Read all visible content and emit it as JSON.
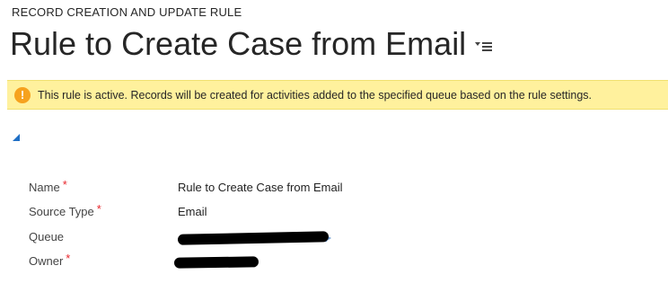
{
  "header": {
    "entity_type": "RECORD CREATION AND UPDATE RULE",
    "record_title": "Rule to Create Case from Email"
  },
  "notification": {
    "icon": "warning-exclamation-icon",
    "text": "This rule is active. Records will be created for activities added to the specified queue based on the rule settings.",
    "background_color": "#fff19d",
    "icon_color": "#f6a21e"
  },
  "section": {
    "toggle_icon": "expand-collapse-triangle-icon"
  },
  "fields": {
    "name": {
      "label": "Name",
      "required": true,
      "value": "Rule to Create Case from Email"
    },
    "source_type": {
      "label": "Source Type",
      "required": true,
      "value": "Email"
    },
    "queue": {
      "label": "Queue",
      "required": false,
      "value_redacted": true
    },
    "owner": {
      "label": "Owner",
      "required": true,
      "value_redacted": true
    }
  },
  "colors": {
    "required_asterisk": "#e8252b",
    "link": "#1160b7",
    "accent_triangle": "#1f6fc5"
  },
  "required_marker": "*"
}
